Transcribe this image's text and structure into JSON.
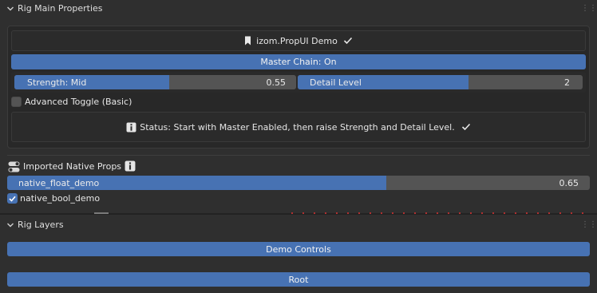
{
  "rig_main": {
    "title": "Rig Main Properties",
    "header_label": "izom.PropUI Demo",
    "master_chain": "Master Chain: On",
    "strength": {
      "label": "Strength: Mid",
      "value": "0.55",
      "fraction": 0.55
    },
    "detail": {
      "label": "Detail Level",
      "value": "2",
      "fraction": 0.6
    },
    "advanced_toggle": "Advanced Toggle (Basic)",
    "status": "Status: Start with Master Enabled, then raise Strength and Detail Level."
  },
  "imported": {
    "title": "Imported Native Props",
    "float": {
      "label": "native_float_demo",
      "value": "0.65",
      "fraction": 0.65
    },
    "bool": {
      "label": "native_bool_demo",
      "checked": true
    }
  },
  "rig_layers": {
    "title": "Rig Layers",
    "buttons": [
      "Demo Controls",
      "Root"
    ]
  },
  "colors": {
    "accent": "#4772b3",
    "panel": "#2f2f2f",
    "field": "#545454"
  },
  "icons": [
    "chevron-down-icon",
    "drag-grip-icon",
    "bookmark-icon",
    "checkmark-icon",
    "info-icon",
    "toggle-icon",
    "checkbox-icon"
  ]
}
